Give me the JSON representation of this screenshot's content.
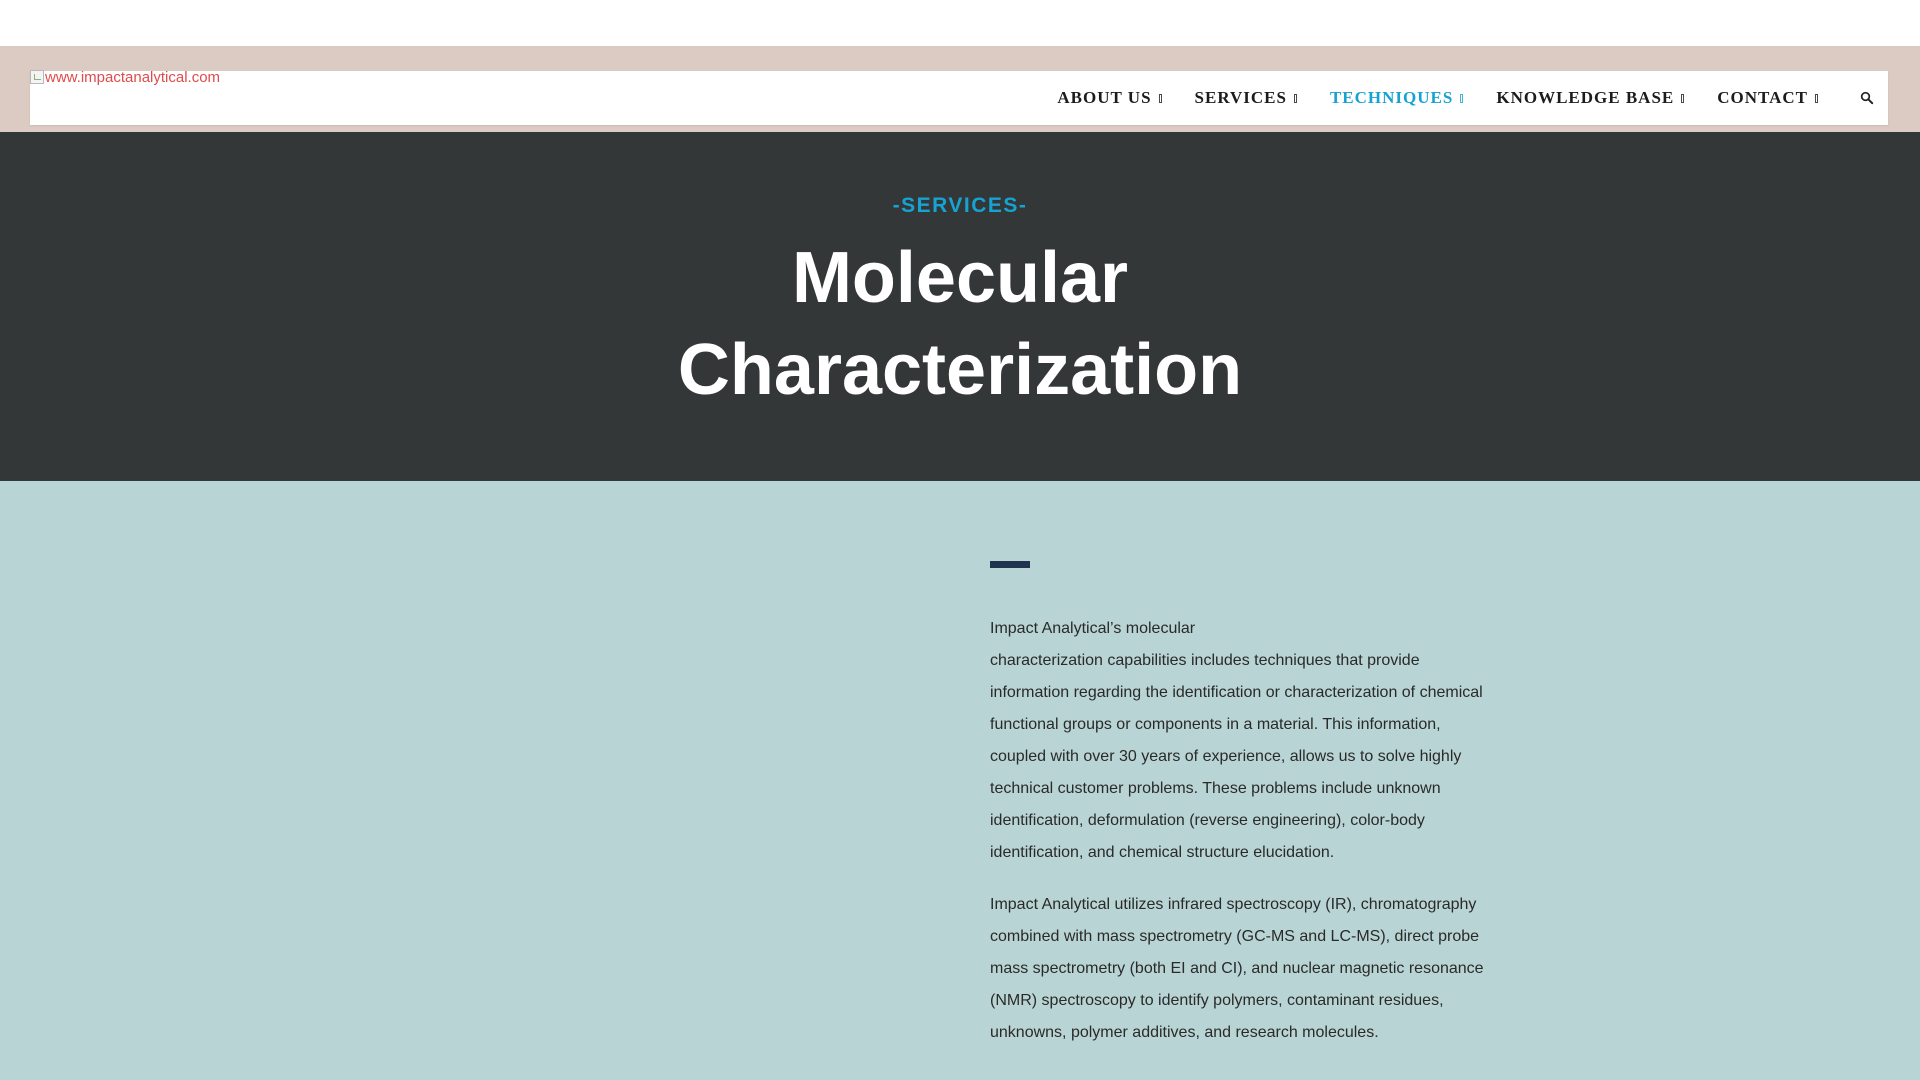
{
  "logo": {
    "alt_text": "www.impactanalytical.com"
  },
  "nav": {
    "items": [
      {
        "label": "ABOUT US",
        "active": false
      },
      {
        "label": "SERVICES",
        "active": false
      },
      {
        "label": "TECHNIQUES",
        "active": true
      },
      {
        "label": "KNOWLEDGE BASE",
        "active": false
      },
      {
        "label": "CONTACT",
        "active": false
      }
    ],
    "search_icon": "search-icon"
  },
  "hero": {
    "kicker": "-SERVICES-",
    "title_line1": "Molecular",
    "title_line2": "Characterization"
  },
  "content": {
    "para1_line1": "Impact Analytical’s molecular",
    "para1_rest": "characterization capabilities includes techniques that provide information regarding the identification or characterization of chemical functional groups or components in a material. This information, coupled with over 30 years of experience, allows us to solve highly technical customer problems. These problems include unknown identification, deformulation (reverse engineering), color-body identification, and chemical structure elucidation.",
    "para2": "Impact Analytical utilizes infrared spectroscopy (IR), chromatography combined with mass spectrometry (GC-MS and LC-MS), direct probe mass spectrometry (both EI and CI), and nuclear magnetic resonance (NMR) spectroscopy to identify polymers, contaminant residues, unknowns, polymer additives, and research molecules."
  },
  "colors": {
    "accent": "#17a3d2",
    "hero_bg": "#343738",
    "content_bg": "#b9d4d4",
    "header_band": "#dccbc2",
    "accent_bar": "#1f3350"
  }
}
